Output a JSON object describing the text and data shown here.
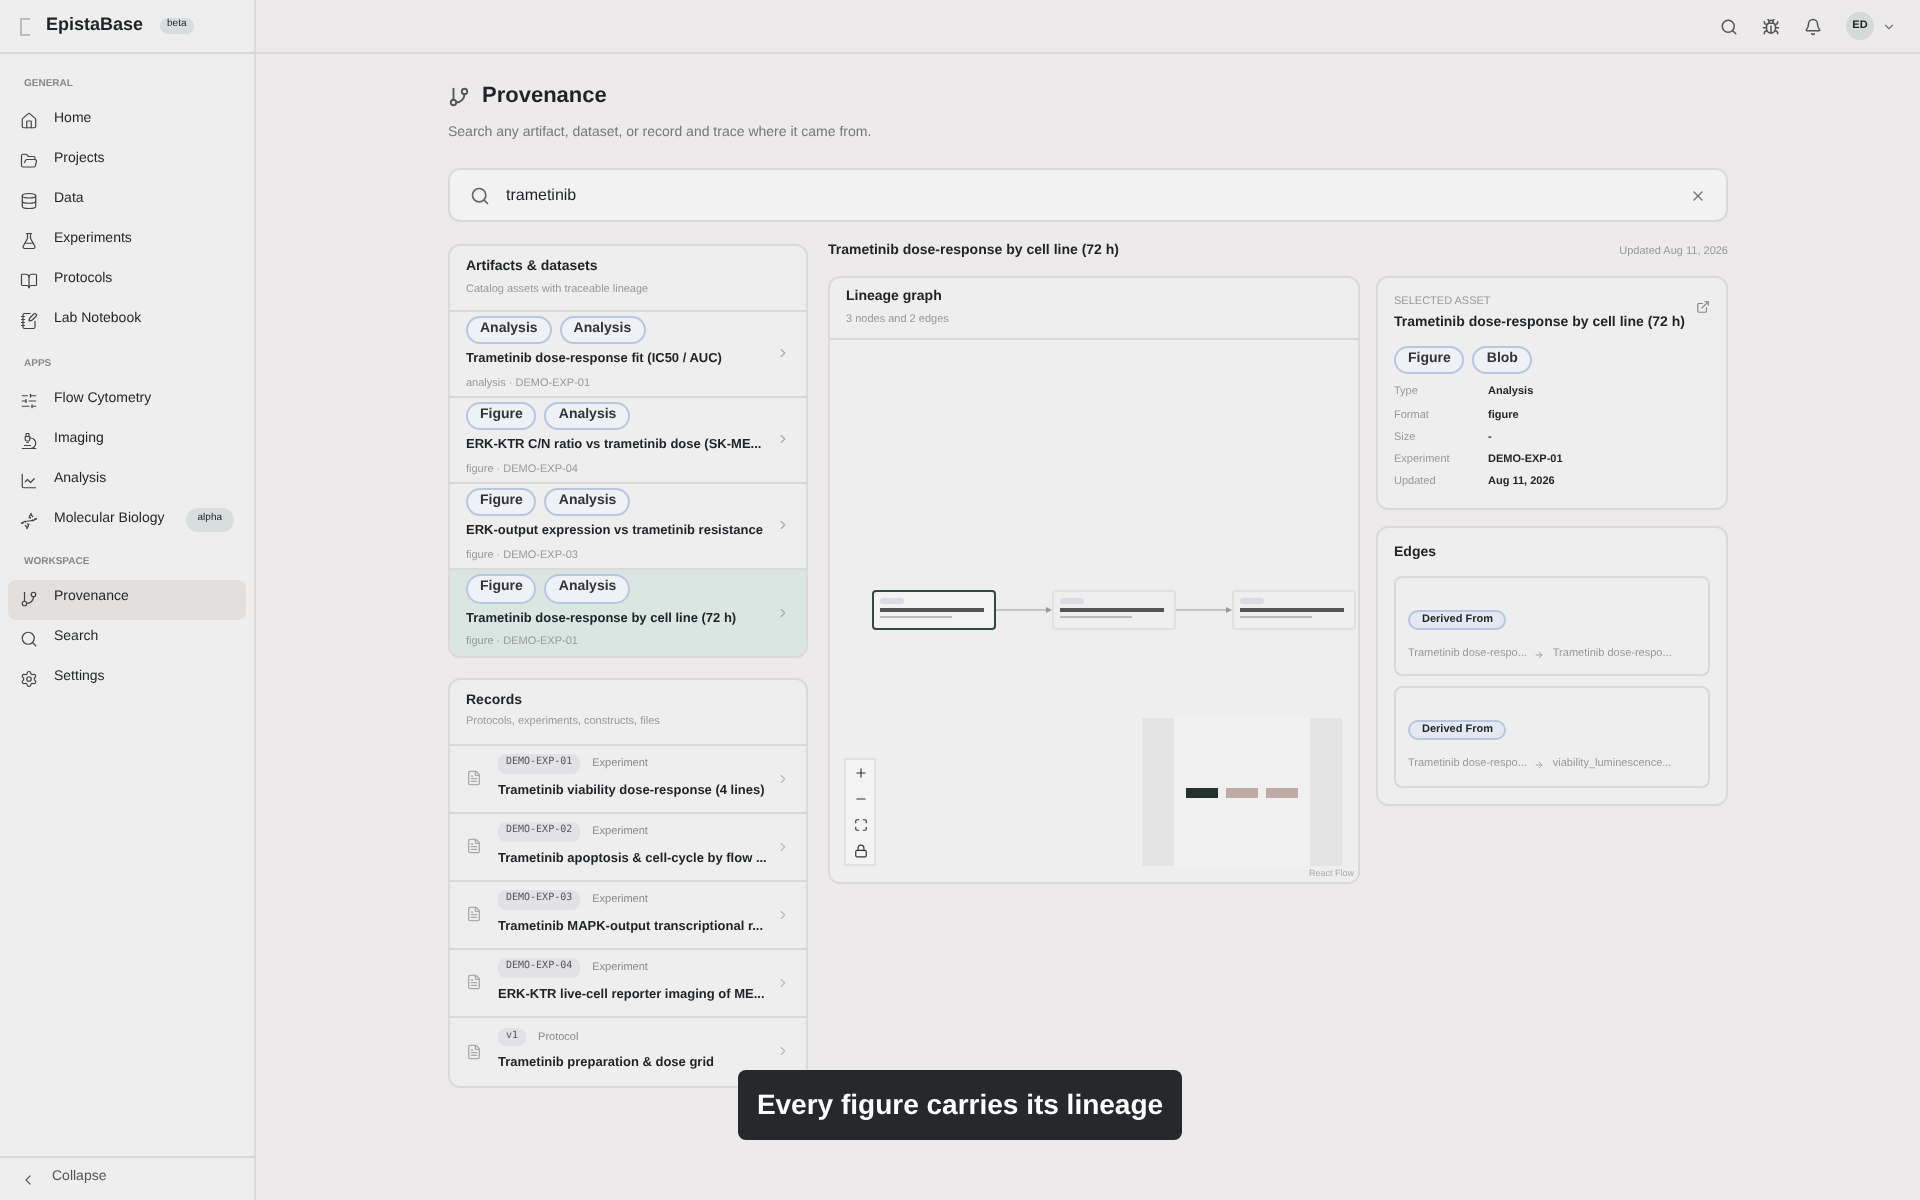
{
  "brand": {
    "name": "EpistaBase",
    "badge": "beta"
  },
  "sidebar": {
    "sections": [
      {
        "title": "GENERAL",
        "items": [
          {
            "label": "Home",
            "selected": false
          },
          {
            "label": "Projects",
            "selected": false
          },
          {
            "label": "Data",
            "selected": false
          },
          {
            "label": "Experiments",
            "selected": false
          },
          {
            "label": "Protocols",
            "selected": false
          },
          {
            "label": "Lab Notebook",
            "selected": false
          }
        ]
      },
      {
        "title": "APPS",
        "items": [
          {
            "label": "Flow Cytometry",
            "selected": false
          },
          {
            "label": "Imaging",
            "selected": false
          },
          {
            "label": "Analysis",
            "selected": false
          },
          {
            "label": "Molecular Biology",
            "selected": false,
            "badge": "alpha"
          }
        ]
      },
      {
        "title": "WORKSPACE",
        "items": [
          {
            "label": "Provenance",
            "selected": true
          },
          {
            "label": "Search",
            "selected": false
          },
          {
            "label": "Settings",
            "selected": false
          }
        ]
      }
    ],
    "collapse": "Collapse"
  },
  "topbar": {
    "avatar": "ED"
  },
  "page": {
    "title": "Provenance",
    "subtitle": "Search any artifact, dataset, or record and trace where it came from."
  },
  "search": {
    "value": "trametinib"
  },
  "artifacts": {
    "title": "Artifacts & datasets",
    "subtitle": "Catalog assets with traceable lineage",
    "items": [
      {
        "tags": [
          "Analysis",
          "Analysis"
        ],
        "title": "Trametinib dose-response fit (IC50 / AUC)",
        "meta": "analysis · DEMO-EXP-01",
        "selected": false
      },
      {
        "tags": [
          "Figure",
          "Analysis"
        ],
        "title": "ERK-KTR C/N ratio vs trametinib dose (SK-ME...",
        "meta": "figure · DEMO-EXP-04",
        "selected": false
      },
      {
        "tags": [
          "Figure",
          "Analysis"
        ],
        "title": "ERK-output expression vs trametinib resistance",
        "meta": "figure · DEMO-EXP-03",
        "selected": false
      },
      {
        "tags": [
          "Figure",
          "Analysis"
        ],
        "title": "Trametinib dose-response by cell line (72 h)",
        "meta": "figure · DEMO-EXP-01",
        "selected": true
      }
    ]
  },
  "records": {
    "title": "Records",
    "subtitle": "Protocols, experiments, constructs, files",
    "items": [
      {
        "code": "DEMO-EXP-01",
        "type": "Experiment",
        "title": "Trametinib viability dose-response (4 lines)"
      },
      {
        "code": "DEMO-EXP-02",
        "type": "Experiment",
        "title": "Trametinib apoptosis & cell-cycle by flow ..."
      },
      {
        "code": "DEMO-EXP-03",
        "type": "Experiment",
        "title": "Trametinib MAPK-output transcriptional r..."
      },
      {
        "code": "DEMO-EXP-04",
        "type": "Experiment",
        "title": "ERK-KTR live-cell reporter imaging of ME..."
      },
      {
        "code": "v1",
        "type": "Protocol",
        "title": "Trametinib preparation & dose grid"
      }
    ]
  },
  "detail": {
    "title": "Trametinib dose-response by cell line (72 h)",
    "updated": "Updated Aug 11, 2026"
  },
  "graph": {
    "title": "Lineage graph",
    "subtitle": "3 nodes and 2 edges",
    "attribution": "React Flow",
    "nodes": [
      {
        "selected": true
      },
      {
        "selected": false
      },
      {
        "selected": false
      }
    ]
  },
  "asset": {
    "label": "SELECTED ASSET",
    "title": "Trametinib dose-response by cell line (72 h)",
    "tags": [
      "Figure",
      "Blob"
    ],
    "fields": [
      {
        "key": "Type",
        "value": "Analysis"
      },
      {
        "key": "Format",
        "value": "figure"
      },
      {
        "key": "Size",
        "value": "-"
      },
      {
        "key": "Experiment",
        "value": "DEMO-EXP-01"
      },
      {
        "key": "Updated",
        "value": "Aug 11, 2026"
      }
    ]
  },
  "edges_panel": {
    "title": "Edges",
    "items": [
      {
        "label": "Derived From",
        "from": "Trametinib dose-respo...",
        "to": "Trametinib dose-respo..."
      },
      {
        "label": "Derived From",
        "from": "Trametinib dose-respo...",
        "to": "viability_luminescence..."
      }
    ]
  },
  "toast": "Every figure carries its lineage"
}
